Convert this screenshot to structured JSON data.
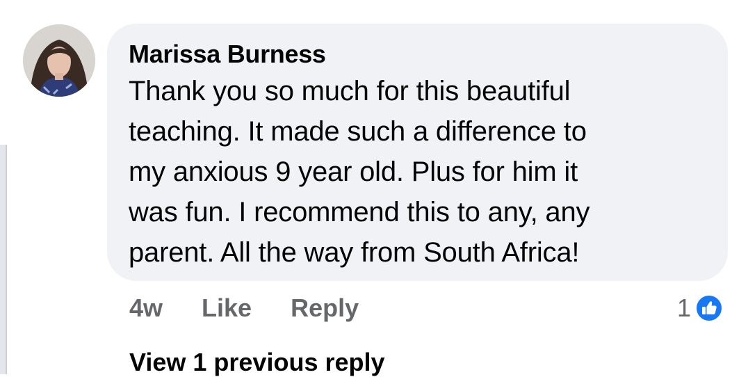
{
  "comment": {
    "author": "Marissa Burness",
    "text_lines": [
      "Thank you so much for this beautiful",
      "teaching. It made such a difference to",
      "my anxious 9 year old. Plus for him it",
      "was fun. I recommend this to any, any",
      "parent. All the way from South Africa!"
    ],
    "timestamp": "4w",
    "like_label": "Like",
    "reply_label": "Reply",
    "reaction_count": "1",
    "reaction_icon": "thumbs-up-icon",
    "view_replies_label": "View 1 previous reply"
  },
  "colors": {
    "bubble": "#f0f2f5",
    "text": "#050505",
    "secondary_text": "#65676b",
    "like_blue": "#1877f2"
  }
}
